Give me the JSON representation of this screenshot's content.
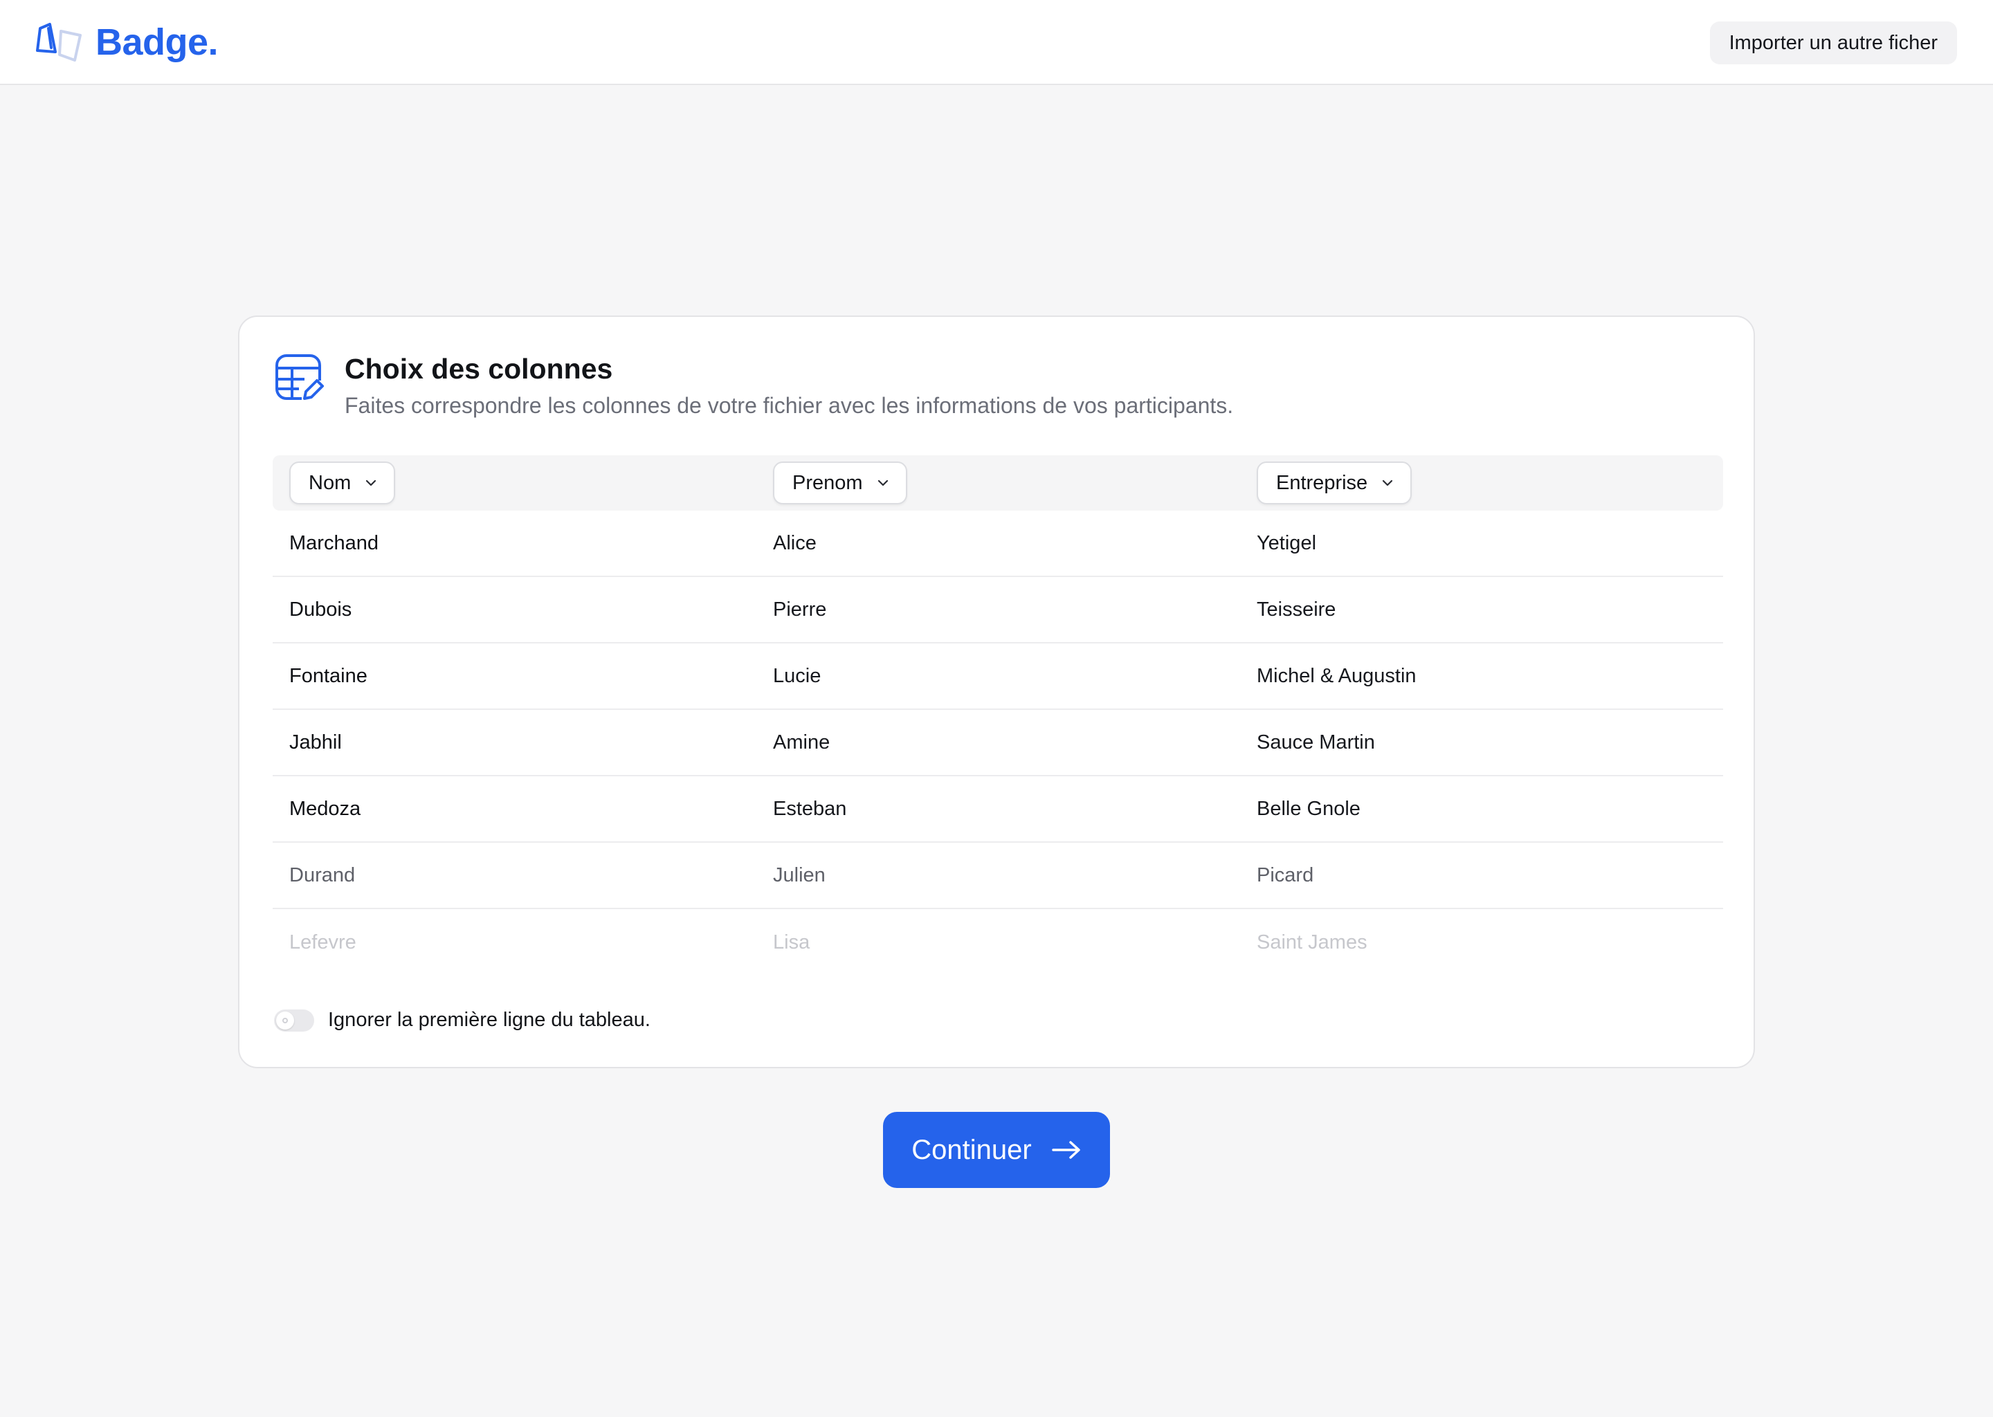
{
  "header": {
    "brand": "Badge.",
    "import_button": "Importer un autre ficher"
  },
  "card": {
    "title": "Choix des colonnes",
    "subtitle": "Faites correspondre les colonnes de votre fichier avec les informations de vos participants.",
    "columns": [
      {
        "label": "Nom"
      },
      {
        "label": "Prenom"
      },
      {
        "label": "Entreprise"
      }
    ],
    "rows": [
      [
        "Marchand",
        "Alice",
        "Yetigel"
      ],
      [
        "Dubois",
        "Pierre",
        "Teisseire"
      ],
      [
        "Fontaine",
        "Lucie",
        "Michel & Augustin"
      ],
      [
        "Jabhil",
        "Amine",
        "Sauce Martin"
      ],
      [
        "Medoza",
        "Esteban",
        "Belle Gnole"
      ],
      [
        "Durand",
        "Julien",
        "Picard"
      ],
      [
        "Lefevre",
        "Lisa",
        "Saint James"
      ]
    ],
    "toggle": {
      "label": "Ignorer la première ligne du tableau.",
      "on": false
    }
  },
  "footer": {
    "continue_label": "Continuer"
  },
  "colors": {
    "accent": "#2563eb",
    "background": "#f6f6f7"
  }
}
